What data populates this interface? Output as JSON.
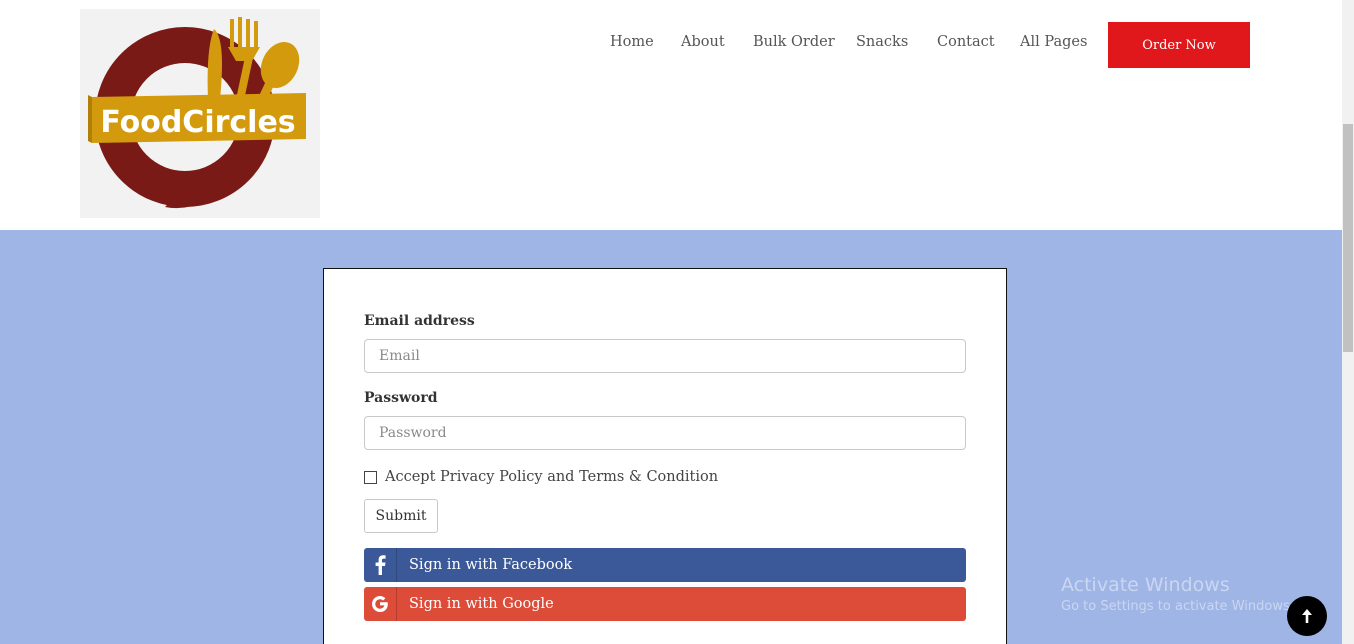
{
  "brand": {
    "name": "FoodCircles"
  },
  "nav": {
    "items": [
      "Home",
      "About",
      "Bulk Order",
      "Snacks",
      "Contact",
      "All Pages"
    ],
    "order_button": "Order Now"
  },
  "form": {
    "email_label": "Email address",
    "email_placeholder": "Email",
    "password_label": "Password",
    "password_placeholder": "Password",
    "accept_label": "Accept Privacy Policy and Terms & Condition",
    "submit_label": "Submit",
    "facebook_label": "Sign in with Facebook",
    "google_label": "Sign in with Google"
  },
  "watermark": {
    "title": "Activate Windows",
    "subtitle": "Go to Settings to activate Windows."
  },
  "colors": {
    "accent_red": "#e0181b",
    "page_bg_blue": "#9fb5e5",
    "facebook": "#3b5998",
    "google": "#dd4b39",
    "logo_maroon": "#7a1a16",
    "logo_gold": "#d49a0d"
  },
  "icons": [
    "facebook-icon",
    "google-icon",
    "arrow-up-icon",
    "fork-icon",
    "spoon-icon"
  ]
}
